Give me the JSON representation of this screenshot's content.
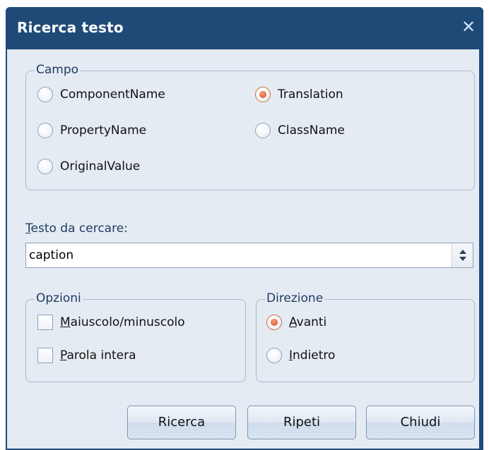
{
  "dialog": {
    "title": "Ricerca testo",
    "close_glyph": "✕"
  },
  "campo": {
    "legend": "Campo",
    "options": [
      {
        "label": "ComponentName",
        "selected": false
      },
      {
        "label": "Translation",
        "selected": true
      },
      {
        "label": "PropertyName",
        "selected": false
      },
      {
        "label": "ClassName",
        "selected": false
      },
      {
        "label": "OriginalValue",
        "selected": false
      }
    ]
  },
  "search": {
    "label_first": "T",
    "label_rest": "esto da cercare:",
    "value": "caption"
  },
  "opzioni": {
    "legend": "Opzioni",
    "case": {
      "first": "M",
      "rest": "aiuscolo/minuscolo",
      "checked": false
    },
    "whole": {
      "first": "P",
      "rest": "arola intera",
      "checked": false
    }
  },
  "direzione": {
    "legend": "Direzione",
    "forward": {
      "first": "A",
      "rest": "vanti",
      "selected": true
    },
    "backward": {
      "first": "I",
      "rest": "ndietro",
      "selected": false
    }
  },
  "buttons": {
    "search": "Ricerca",
    "repeat": "Ripeti",
    "close": "Chiudi"
  },
  "colors": {
    "titlebar": "#1f4a78",
    "client": "#e5ebf3",
    "radio_selected": "#e46a3e"
  }
}
